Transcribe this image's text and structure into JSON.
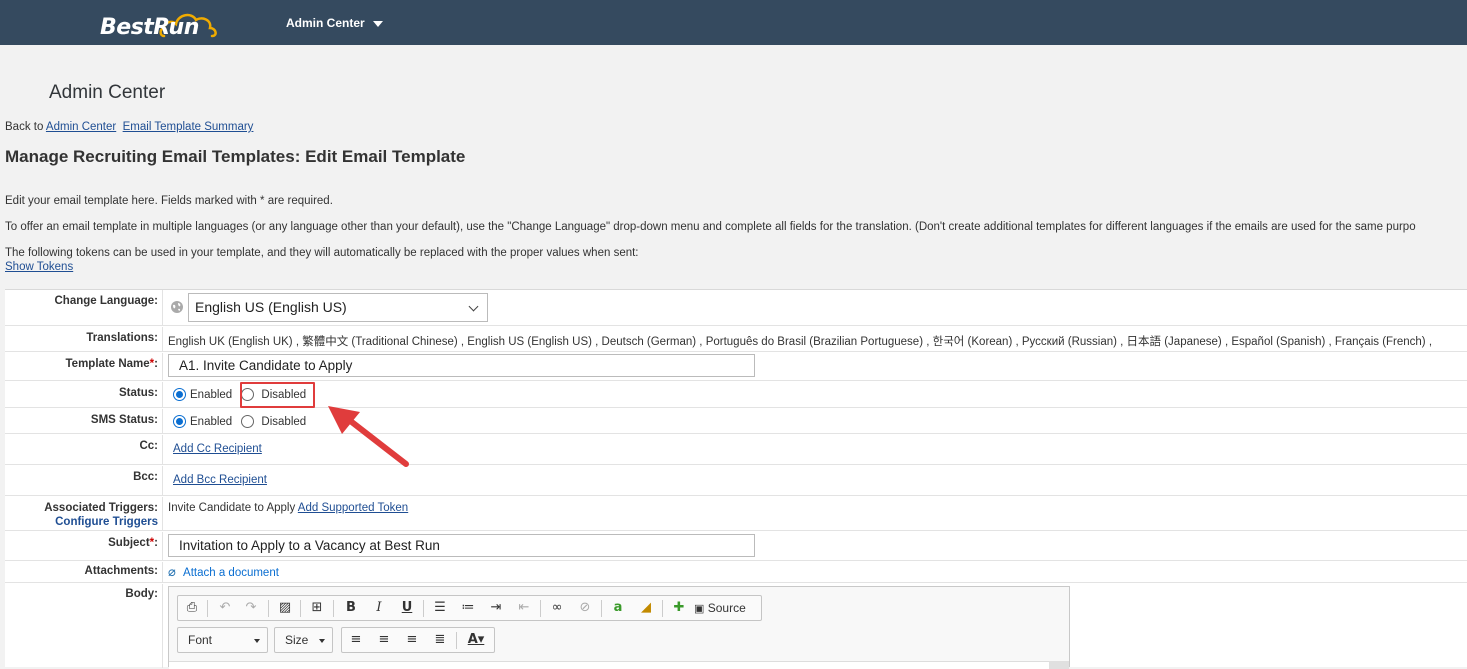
{
  "brand": {
    "logo_text": "BestRun"
  },
  "header": {
    "app_menu": "Admin Center"
  },
  "page": {
    "heading": "Admin Center",
    "back_prefix": "Back to",
    "back_link_1": "Admin Center",
    "back_link_2": "Email Template Summary",
    "title": "Manage Recruiting Email Templates: Edit Email Template",
    "intro_1": "Edit your email template here. Fields marked with * are required.",
    "intro_2": "To offer an email template in multiple languages (or any language other than your default), use the \"Change Language\" drop-down menu and complete all fields for the translation. (Don't create additional templates for different languages if the emails are used for the same purpo",
    "intro_3": "The following tokens can be used in your template, and they will automatically be replaced with the proper values when sent:",
    "show_tokens": "Show Tokens"
  },
  "form": {
    "change_language_label": "Change Language:",
    "language_value": "English US (English US)",
    "translations_label": "Translations:",
    "translations_value": "English UK (English UK) , 繁體中文 (Traditional Chinese) , English US (English US) , Deutsch (German) , Português do Brasil (Brazilian Portuguese) , 한국어 (Korean) , Русский (Russian) , 日本語 (Japanese) , Español (Spanish) , Français (French) ,",
    "template_name_label": "Template Name",
    "template_name_value": "A1. Invite Candidate to Apply",
    "status_label": "Status:",
    "status_enabled": "Enabled",
    "status_disabled": "Disabled",
    "sms_status_label": "SMS Status:",
    "sms_enabled": "Enabled",
    "sms_disabled": "Disabled",
    "cc_label": "Cc:",
    "add_cc": "Add Cc Recipient",
    "bcc_label": "Bcc:",
    "add_bcc": "Add Bcc Recipient",
    "triggers_label": "Associated Triggers:",
    "configure_triggers": "Configure Triggers",
    "trigger_value": "Invite Candidate to Apply",
    "add_supported_token": "Add Supported Token",
    "subject_label": "Subject",
    "subject_value": "Invitation to Apply to a Vacancy at Best Run",
    "attachments_label": "Attachments:",
    "attach_doc": "Attach a document",
    "body_label": "Body:"
  },
  "editor": {
    "source_label": "Source",
    "font_label": "Font",
    "size_label": "Size"
  },
  "colors": {
    "topbar": "#354a5f",
    "highlight": "#e03c3c",
    "link": "#1f4e93"
  }
}
